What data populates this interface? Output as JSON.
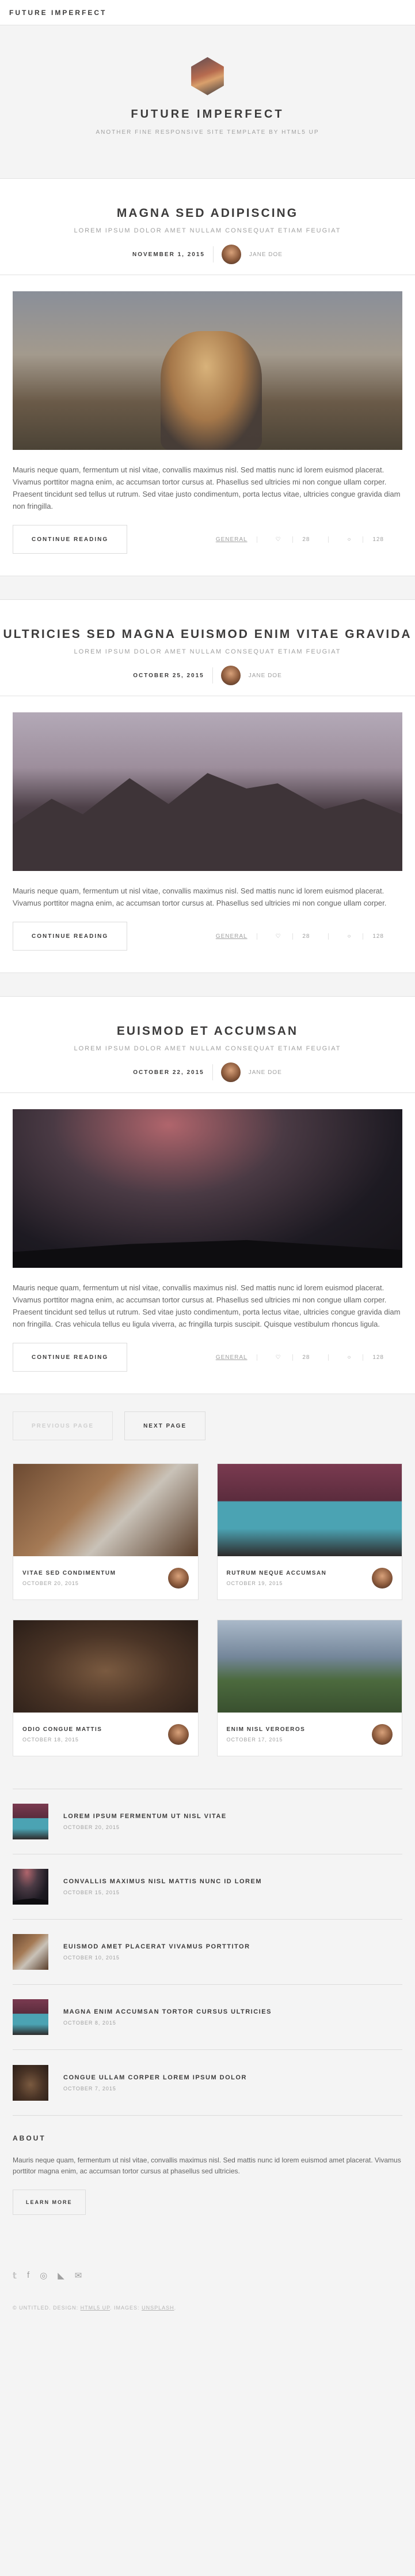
{
  "site_title": "FUTURE IMPERFECT",
  "intro": {
    "title": "FUTURE IMPERFECT",
    "subtitle": "ANOTHER FINE RESPONSIVE SITE TEMPLATE BY HTML5 UP"
  },
  "posts": [
    {
      "title": "MAGNA SED ADIPISCING",
      "subtitle": "LOREM IPSUM DOLOR AMET NULLAM CONSEQUAT ETIAM FEUGIAT",
      "date": "NOVEMBER 1, 2015",
      "author": "JANE DOE",
      "excerpt": "Mauris neque quam, fermentum ut nisl vitae, convallis maximus nisl. Sed mattis nunc id lorem euismod placerat. Vivamus porttitor magna enim, ac accumsan tortor cursus at. Phasellus sed ultricies mi non congue ullam corper. Praesent tincidunt sed tellus ut rutrum. Sed vitae justo condimentum, porta lectus vitae, ultricies congue gravida diam non fringilla.",
      "button": "CONTINUE READING",
      "tag": "GENERAL",
      "likes": "28",
      "comments": "128"
    },
    {
      "title": "ULTRICIES SED MAGNA EUISMOD ENIM VITAE GRAVIDA",
      "subtitle": "LOREM IPSUM DOLOR AMET NULLAM CONSEQUAT ETIAM FEUGIAT",
      "date": "OCTOBER 25, 2015",
      "author": "JANE DOE",
      "excerpt": "Mauris neque quam, fermentum ut nisl vitae, convallis maximus nisl. Sed mattis nunc id lorem euismod placerat. Vivamus porttitor magna enim, ac accumsan tortor cursus at. Phasellus sed ultricies mi non congue ullam corper.",
      "button": "CONTINUE READING",
      "tag": "GENERAL",
      "likes": "28",
      "comments": "128"
    },
    {
      "title": "EUISMOD ET ACCUMSAN",
      "subtitle": "LOREM IPSUM DOLOR AMET NULLAM CONSEQUAT ETIAM FEUGIAT",
      "date": "OCTOBER 22, 2015",
      "author": "JANE DOE",
      "excerpt": "Mauris neque quam, fermentum ut nisl vitae, convallis maximus nisl. Sed mattis nunc id lorem euismod placerat. Vivamus porttitor magna enim, ac accumsan tortor cursus at. Phasellus sed ultricies mi non congue ullam corper. Praesent tincidunt sed tellus ut rutrum. Sed vitae justo condimentum, porta lectus vitae, ultricies congue gravida diam non fringilla. Cras vehicula tellus eu ligula viverra, ac fringilla turpis suscipit. Quisque vestibulum rhoncus ligula.",
      "button": "CONTINUE READING",
      "tag": "GENERAL",
      "likes": "28",
      "comments": "128"
    }
  ],
  "pager": {
    "previous": "PREVIOUS PAGE",
    "next": "NEXT PAGE"
  },
  "mini_posts": [
    {
      "title": "VITAE SED CONDIMENTUM",
      "date": "OCTOBER 20, 2015"
    },
    {
      "title": "RUTRUM NEQUE ACCUMSAN",
      "date": "OCTOBER 19, 2015"
    },
    {
      "title": "ODIO CONGUE MATTIS",
      "date": "OCTOBER 18, 2015"
    },
    {
      "title": "ENIM NISL VEROEROS",
      "date": "OCTOBER 17, 2015"
    }
  ],
  "list_posts": [
    {
      "title": "LOREM IPSUM FERMENTUM UT NISL VITAE",
      "date": "OCTOBER 20, 2015"
    },
    {
      "title": "CONVALLIS MAXIMUS NISL MATTIS NUNC ID LOREM",
      "date": "OCTOBER 15, 2015"
    },
    {
      "title": "EUISMOD AMET PLACERAT VIVAMUS PORTTITOR",
      "date": "OCTOBER 10, 2015"
    },
    {
      "title": "MAGNA ENIM ACCUMSAN TORTOR CURSUS ULTRICIES",
      "date": "OCTOBER 8, 2015"
    },
    {
      "title": "CONGUE ULLAM CORPER LOREM IPSUM DOLOR",
      "date": "OCTOBER 7, 2015"
    }
  ],
  "about": {
    "title": "ABOUT",
    "text": "Mauris neque quam, fermentum ut nisl vitae, convallis maximus nisl. Sed mattis nunc id lorem euismod amet placerat. Vivamus porttitor magna enim, ac accumsan tortor cursus at phasellus sed ultricies.",
    "button": "LEARN MORE"
  },
  "social_icons": [
    "twitter-icon",
    "facebook-icon",
    "instagram-icon",
    "rss-icon",
    "email-icon"
  ],
  "copyright": {
    "text": "© UNTITLED. DESIGN:",
    "design_link": "HTML5 UP",
    "images_label": "IMAGES:",
    "images_link": "UNSPLASH"
  }
}
